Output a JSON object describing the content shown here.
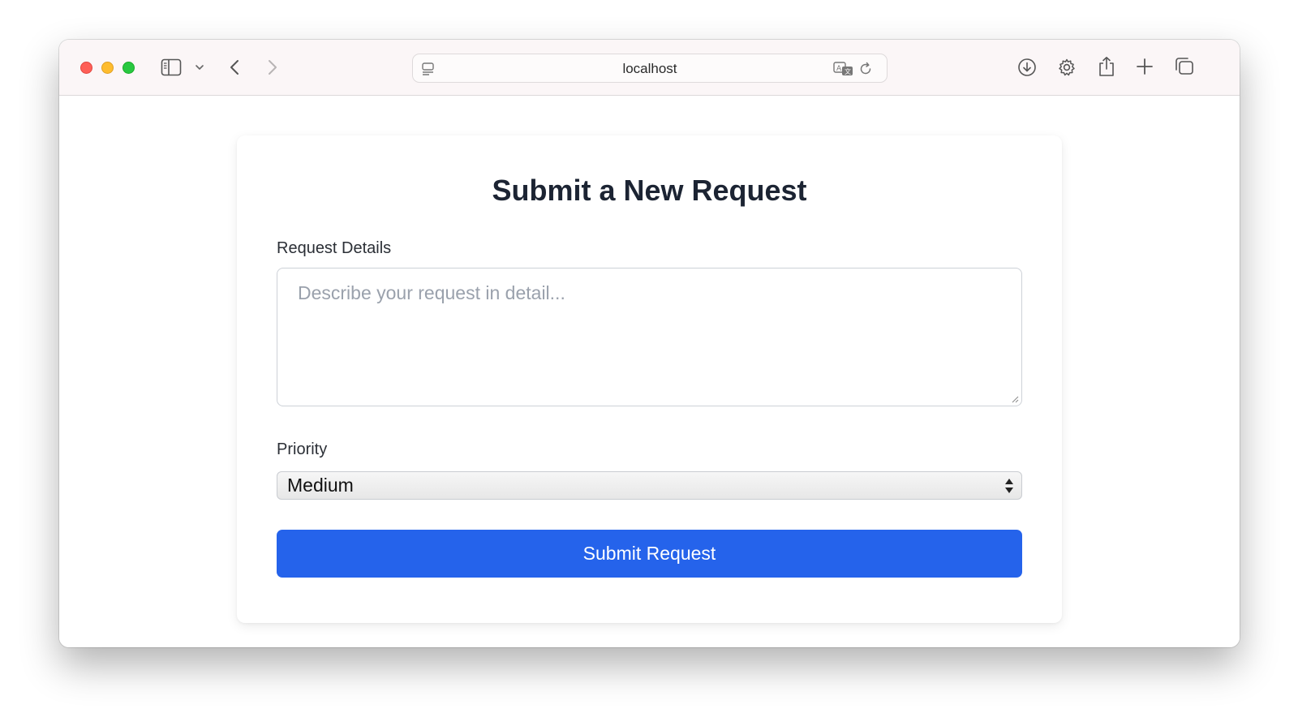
{
  "browser": {
    "url": "localhost"
  },
  "form": {
    "title": "Submit a New Request",
    "details_label": "Request Details",
    "details_placeholder": "Describe your request in detail...",
    "priority_label": "Priority",
    "priority_selected": "Medium",
    "submit_label": "Submit Request"
  },
  "colors": {
    "accent": "#2563eb",
    "heading": "#1c2433",
    "placeholder": "#9aa1ac"
  }
}
